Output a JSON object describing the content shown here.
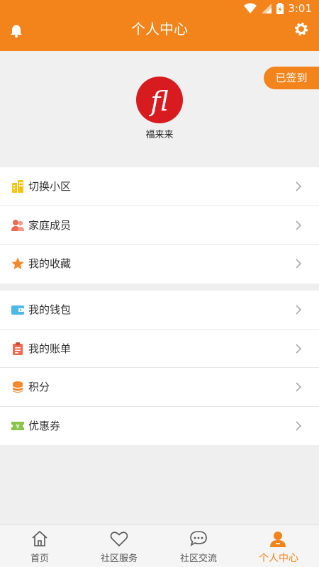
{
  "status": {
    "time": "3:01"
  },
  "header": {
    "title": "个人中心",
    "bell_icon": "bell-icon",
    "settings_icon": "gear-icon"
  },
  "profile": {
    "signin_label": "已签到",
    "avatar_text": "fl",
    "username": "福来来"
  },
  "menu_group1": [
    {
      "label": "切换小区",
      "icon": "building-icon"
    },
    {
      "label": "家庭成员",
      "icon": "family-icon"
    },
    {
      "label": "我的收藏",
      "icon": "star-icon"
    }
  ],
  "menu_group2": [
    {
      "label": "我的钱包",
      "icon": "wallet-icon"
    },
    {
      "label": "我的账单",
      "icon": "bill-icon"
    },
    {
      "label": "积分",
      "icon": "coins-icon"
    },
    {
      "label": "优惠券",
      "icon": "coupon-icon"
    }
  ],
  "tabs": [
    {
      "label": "首页",
      "icon": "home-icon"
    },
    {
      "label": "社区服务",
      "icon": "heart-icon"
    },
    {
      "label": "社区交流",
      "icon": "chat-icon"
    },
    {
      "label": "个人中心",
      "icon": "person-icon",
      "active": true
    }
  ],
  "colors": {
    "accent": "#f3831b",
    "avatar_red": "#d71b1f"
  }
}
